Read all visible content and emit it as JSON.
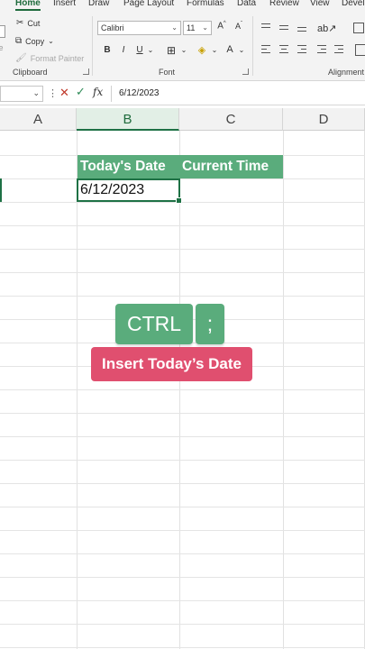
{
  "ribbon_tabs": [
    "Home",
    "Insert",
    "Draw",
    "Page Layout",
    "Formulas",
    "Data",
    "Review",
    "View",
    "Develo"
  ],
  "active_tab": "Home",
  "clipboard": {
    "paste_fragment": "te",
    "cut": "Cut",
    "copy": "Copy",
    "format_painter": "Format Painter",
    "group_label": "Clipboard"
  },
  "font": {
    "font_name": "Calibri",
    "font_size": "11",
    "group_label": "Font",
    "bold": "B",
    "italic": "I",
    "underline": "U"
  },
  "alignment": {
    "group_label": "Alignment"
  },
  "formula_bar": {
    "name_box": "",
    "fx": "fx",
    "value": "6/12/2023"
  },
  "columns": [
    "A",
    "B",
    "C",
    "D"
  ],
  "selected_column": "B",
  "cells": {
    "b_header": "Today's Date",
    "c_header": "Current Time",
    "b_value": "6/12/2023"
  },
  "overlay": {
    "key1": "CTRL",
    "key2": ";",
    "caption": "Insert Today’s Date"
  },
  "colors": {
    "excel_green": "#1e7145",
    "header_fill": "#5aac7c",
    "caption_pink": "#e04f6f"
  }
}
